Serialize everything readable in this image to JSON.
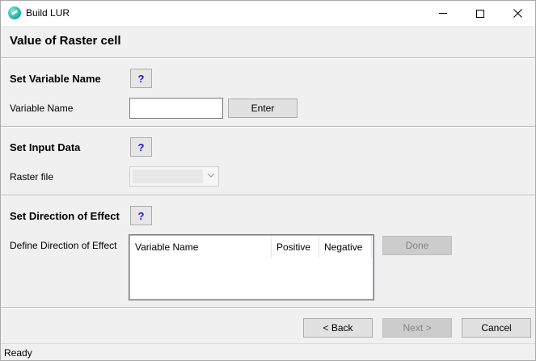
{
  "window": {
    "title": "Build LUR",
    "icon": "app-globe-icon"
  },
  "page": {
    "title": "Value of Raster cell"
  },
  "variable_section": {
    "title": "Set Variable Name",
    "help_label": "?",
    "field_label": "Variable Name",
    "input_value": "",
    "enter_label": "Enter"
  },
  "input_section": {
    "title": "Set Input Data",
    "help_label": "?",
    "field_label": "Raster file",
    "raster_selected": ""
  },
  "direction_section": {
    "title": "Set Direction of Effect",
    "help_label": "?",
    "field_label": "Define Direction of Effect",
    "columns": [
      "Variable  Name",
      "Positive",
      "Negative"
    ],
    "rows": [],
    "done_label": "Done"
  },
  "nav": {
    "back_label": "< Back",
    "next_label": "Next >",
    "cancel_label": "Cancel"
  },
  "status": {
    "text": "Ready"
  }
}
